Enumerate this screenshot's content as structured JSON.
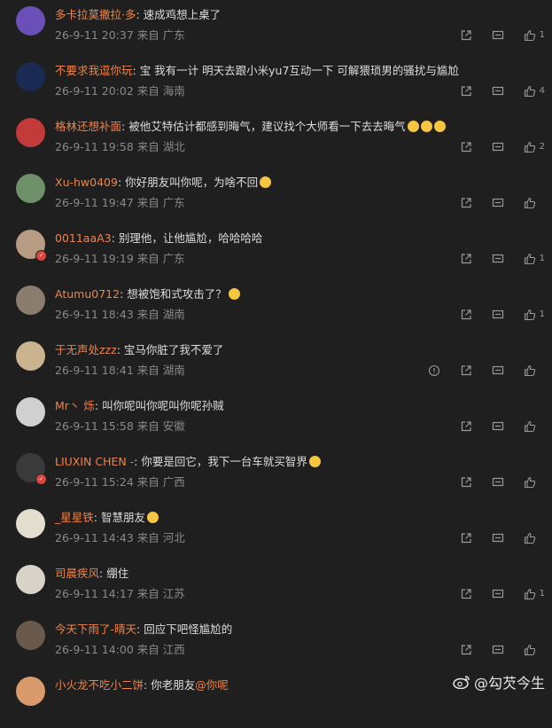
{
  "comments": [
    {
      "user": "多卡拉莫撒拉·多",
      "text": "速成鸡想上桌了",
      "date": "26-9-11 20:37",
      "location": "来自 广东",
      "likes": "1",
      "avatar_color": "#6b4fb8",
      "badge": false
    },
    {
      "user": "不要求我逗你玩",
      "text": "宝 我有一计 明天去跟小米yu7互动一下 可解猥琐男的骚扰与尴尬",
      "date": "26-9-11 20:02",
      "location": "来自 海南",
      "likes": "4",
      "avatar_color": "#1b2a52",
      "badge": false
    },
    {
      "user": "格林还想补面",
      "text": "被他艾特估计都感到晦气，建议找个大师看一下去去晦气",
      "date": "26-9-11 19:58",
      "location": "来自 湖北",
      "likes": "2",
      "avatar_color": "#c23a3a",
      "badge": false
    },
    {
      "user": "Xu-hw0409",
      "text": "你好朋友叫你呢，为啥不回",
      "date": "26-9-11 19:47",
      "location": "来自 广东",
      "likes": "",
      "avatar_color": "#6f8f6a",
      "badge": false
    },
    {
      "user": "0011aaA3",
      "text": "别理他，让他尴尬，哈哈哈哈",
      "date": "26-9-11 19:19",
      "location": "来自 广东",
      "likes": "1",
      "avatar_color": "#b89b83",
      "badge": true
    },
    {
      "user": "Atumu0712",
      "text": "想被饱和式攻击了？",
      "date": "26-9-11 18:43",
      "location": "来自 湖南",
      "likes": "1",
      "avatar_color": "#8a7d70",
      "badge": false
    },
    {
      "user": "于无声处zzz",
      "text": "宝马你脏了我不爱了",
      "date": "26-9-11 18:41",
      "location": "来自 湖南",
      "likes": "",
      "avatar_color": "#c9b48f",
      "badge": false
    },
    {
      "user": "Mr丶 烁",
      "text": "叫你呢叫你呢叫你呢孙贼",
      "date": "26-9-11 15:58",
      "location": "来自 安徽",
      "likes": "",
      "avatar_color": "#d0d0d0",
      "badge": false
    },
    {
      "user": "LIUXIN CHEN -",
      "text": "你要是回它，我下一台车就买智界",
      "date": "26-9-11 15:24",
      "location": "来自 广西",
      "likes": "",
      "avatar_color": "#3a3a3a",
      "badge": true
    },
    {
      "user": "_星星铁",
      "text": "智慧朋友",
      "date": "26-9-11 14:43",
      "location": "来自 河北",
      "likes": "",
      "avatar_color": "#e3ddd0",
      "badge": false
    },
    {
      "user": "司晨疾风",
      "text": "绷住",
      "date": "26-9-11 14:17",
      "location": "来自 江苏",
      "likes": "1",
      "avatar_color": "#d8d2c8",
      "badge": false
    },
    {
      "user": "今天下雨了-晴天",
      "text": "回应下吧怪尴尬的",
      "date": "26-9-11 14:00",
      "location": "来自 江西",
      "likes": "",
      "avatar_color": "#6a5a4e",
      "badge": false
    },
    {
      "user": "小火龙不吃小二饼",
      "text": "你老朋友",
      "mention": "@你呢",
      "date": "",
      "location": "",
      "likes": "",
      "avatar_color": "#d89a6a",
      "badge": false
    }
  ],
  "watermark": "@勾芡今生"
}
